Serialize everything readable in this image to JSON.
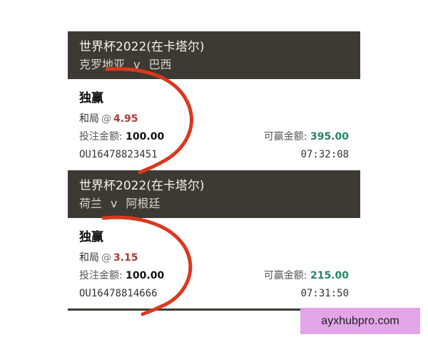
{
  "bets": [
    {
      "event": "世界杯2022(在卡塔尔)",
      "home": "克罗地亚",
      "vs": "v",
      "away": "巴西",
      "bet_type": "独赢",
      "selection": "和局",
      "at": "@",
      "odds": "4.95",
      "stake_label": "投注金额:",
      "stake": "100.00",
      "payout_label": "可赢金额:",
      "payout": "395.00",
      "reference": "OU16478823451",
      "time": "07:32:08"
    },
    {
      "event": "世界杯2022(在卡塔尔)",
      "home": "荷兰",
      "vs": "v",
      "away": "阿根廷",
      "bet_type": "独赢",
      "selection": "和局",
      "at": "@",
      "odds": "3.15",
      "stake_label": "投注金额:",
      "stake": "100.00",
      "payout_label": "可赢金额:",
      "payout": "215.00",
      "reference": "OU16478814666",
      "time": "07:31:50"
    }
  ],
  "watermark": "ayxhubpro.com",
  "colors": {
    "header_bg": "#3d3a33",
    "odds": "#b13a36",
    "payout": "#24865f",
    "annotation": "#d9391e",
    "watermark_bg": "#e2a6e8"
  }
}
